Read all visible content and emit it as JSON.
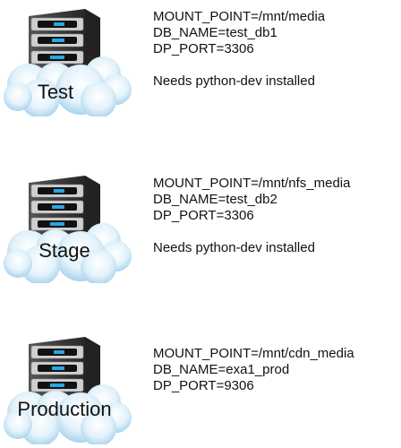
{
  "environments": [
    {
      "name": "Test",
      "mount_point": "MOUNT_POINT=/mnt/media",
      "db_name": "DB_NAME=test_db1",
      "dp_port": "DP_PORT=3306",
      "note": "Needs python-dev installed"
    },
    {
      "name": "Stage",
      "mount_point": "MOUNT_POINT=/mnt/nfs_media",
      "db_name": "DB_NAME=test_db2",
      "dp_port": "DP_PORT=3306",
      "note": "Needs python-dev installed"
    },
    {
      "name": "Production",
      "mount_point": "MOUNT_POINT=/mnt/cdn_media",
      "db_name": "DB_NAME=exa1_prod",
      "dp_port": "DP_PORT=9306"
    }
  ],
  "colors": {
    "cloud": "#d6ecf8",
    "server": "#2b2b2b",
    "led": "#27a8e0"
  }
}
